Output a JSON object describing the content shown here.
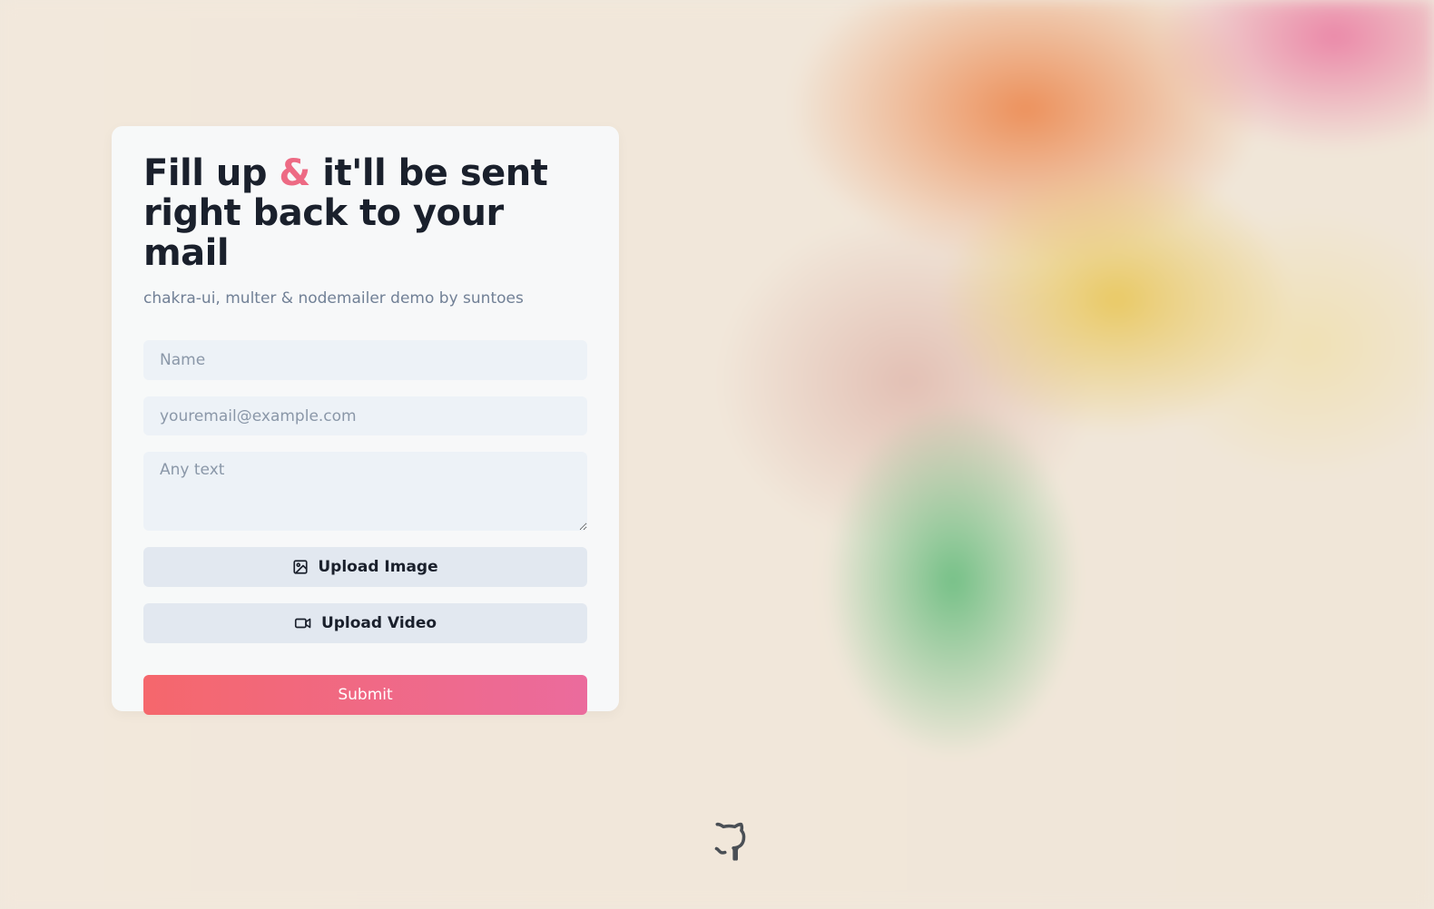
{
  "hero": {
    "title_part1": "Fill up ",
    "title_amp": "&",
    "title_part2": " it'll be sent right back to your mail",
    "subtitle": "chakra-ui, multer & nodemailer demo by suntoes"
  },
  "form": {
    "name_placeholder": "Name",
    "email_placeholder": "youremail@example.com",
    "text_placeholder": "Any text",
    "upload_image_label": "Upload Image",
    "upload_video_label": "Upload Video",
    "submit_label": "Submit"
  },
  "icons": {
    "upload_image": "image-icon",
    "upload_video": "video-camera-icon",
    "footer": "github-icon"
  },
  "colors": {
    "accent": "#ed6a84",
    "submit_gradient_start": "#f5676c",
    "submit_gradient_end": "#eb6b9d",
    "title": "#1a202c",
    "subtitle": "#718096"
  }
}
